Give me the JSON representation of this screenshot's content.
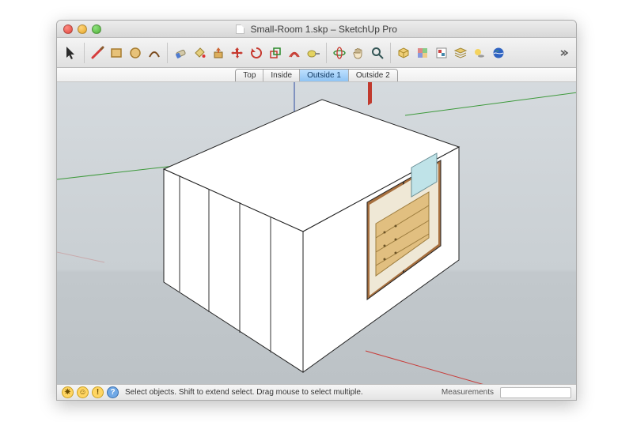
{
  "window": {
    "title_file": "Small-Room 1.skp",
    "title_app": "SketchUp Pro"
  },
  "toolbar_groups": {
    "select": "select-tool",
    "draw": [
      "line-tool",
      "rectangle-tool",
      "circle-tool",
      "arc-tool"
    ],
    "edit": [
      "eraser-tool",
      "paint-bucket-tool",
      "push-pull-tool",
      "move-tool",
      "rotate-tool",
      "scale-tool",
      "offset-tool",
      "tape-measure-tool"
    ],
    "view": [
      "orbit-tool",
      "pan-tool",
      "zoom-tool"
    ],
    "extra": [
      "components-tool",
      "materials-tool",
      "styles-tool",
      "layers-tool",
      "shadows-tool",
      "google-earth-tool"
    ]
  },
  "scene_tabs": {
    "items": [
      "Top",
      "Inside",
      "Outside 1",
      "Outside 2"
    ],
    "active_index": 2
  },
  "statusbar": {
    "hint": "Select objects. Shift to extend select. Drag mouse to select multiple.",
    "measurements_label": "Measurements",
    "measurements_value": ""
  },
  "accent_colors": {
    "axis_red": "#c83d3a",
    "axis_green": "#3e9a3c",
    "axis_blue": "#2b4aa0"
  }
}
